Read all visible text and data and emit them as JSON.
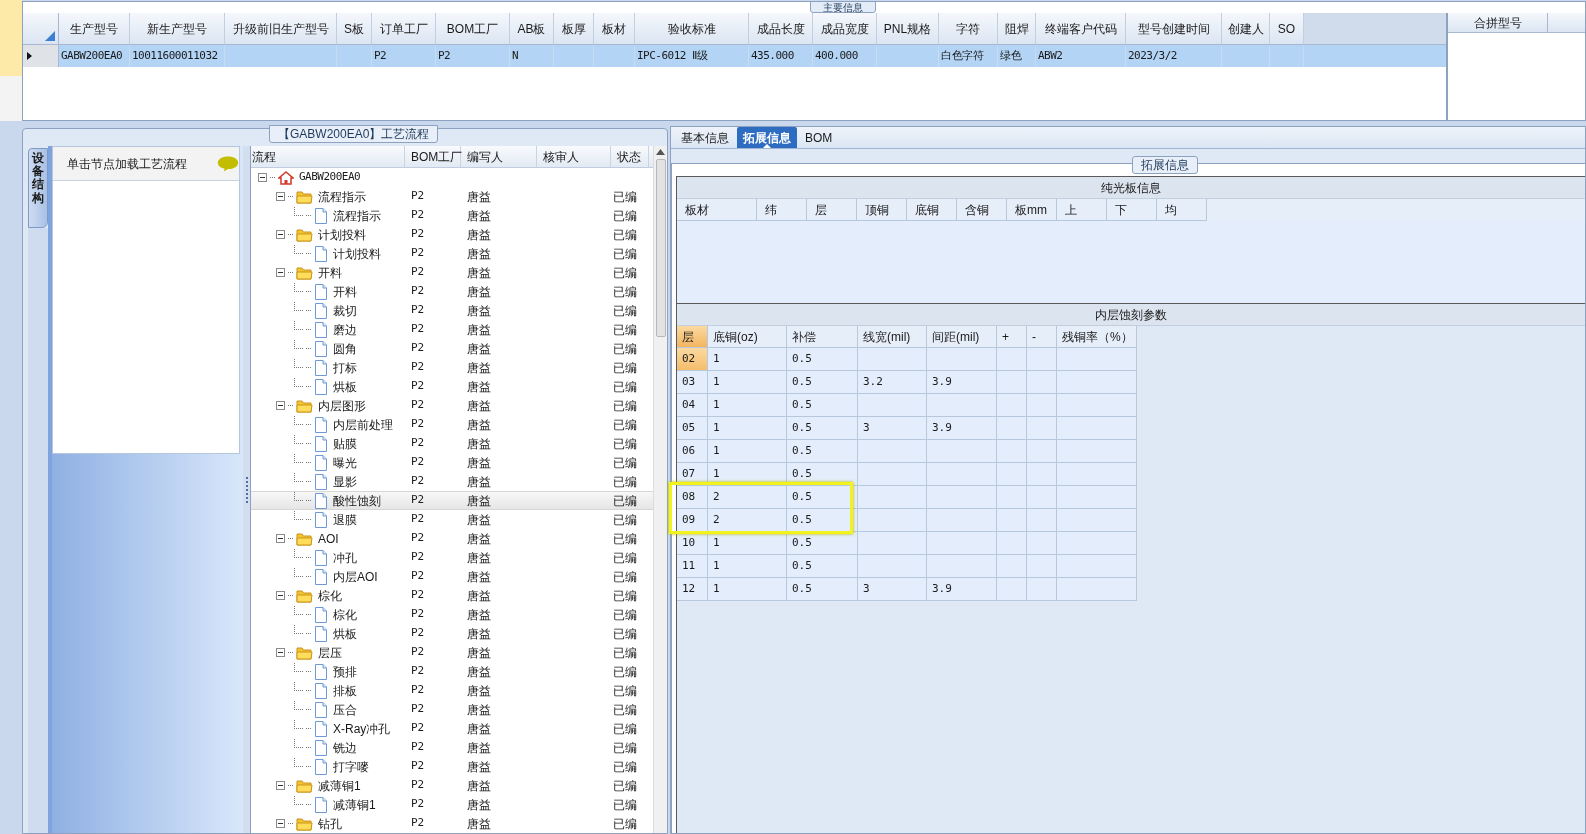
{
  "main_info": {
    "title": "主要信息",
    "columns": [
      "生产型号",
      "新生产型号",
      "升级前旧生产型号",
      "S板",
      "订单工厂",
      "BOM工厂",
      "AB板",
      "板厚",
      "板材",
      "验收标准",
      "成品长度",
      "成品宽度",
      "PNL规格",
      "字符",
      "阻焊",
      "终端客户代码",
      "型号创建时间",
      "创建人",
      "SO"
    ],
    "rows": [
      {
        "selected": true,
        "cells": [
          "GABW200EA0",
          "10011600011032",
          null,
          null,
          "P2",
          "P2",
          "N",
          null,
          null,
          "IPC-6012 Ⅱ级",
          "435.000",
          "400.000",
          null,
          "白色字符",
          "绿色",
          "ABW2",
          "2023/3/2",
          null,
          null
        ]
      }
    ]
  },
  "merge_panel": {
    "columns": [
      "合拼型号"
    ]
  },
  "process": {
    "title": "【GABW200EA0】工艺流程",
    "side_tab": "设备结构",
    "hint": "单击节点加载工艺流程",
    "columns": [
      "流程",
      "BOM工厂",
      "编写人",
      "核审人",
      "状态"
    ],
    "tree": [
      {
        "kind": "root",
        "label": "GABW200EA0",
        "expanded": true,
        "selected": false,
        "children": [
          {
            "kind": "folder",
            "label": "流程指示",
            "bom": "P2",
            "writer": "唐益",
            "status": "已编",
            "expanded": true,
            "selected": false,
            "children": [
              {
                "kind": "file",
                "label": "流程指示",
                "bom": "P2",
                "writer": "唐益",
                "status": "已编",
                "selected": false
              }
            ]
          },
          {
            "kind": "folder",
            "label": "计划投料",
            "bom": "P2",
            "writer": "唐益",
            "status": "已编",
            "expanded": true,
            "selected": false,
            "children": [
              {
                "kind": "file",
                "label": "计划投料",
                "bom": "P2",
                "writer": "唐益",
                "status": "已编",
                "selected": false
              }
            ]
          },
          {
            "kind": "folder",
            "label": "开料",
            "bom": "P2",
            "writer": "唐益",
            "status": "已编",
            "expanded": true,
            "selected": false,
            "children": [
              {
                "kind": "file",
                "label": "开料",
                "bom": "P2",
                "writer": "唐益",
                "status": "已编",
                "selected": false
              },
              {
                "kind": "file",
                "label": "裁切",
                "bom": "P2",
                "writer": "唐益",
                "status": "已编",
                "selected": false
              },
              {
                "kind": "file",
                "label": "磨边",
                "bom": "P2",
                "writer": "唐益",
                "status": "已编",
                "selected": false
              },
              {
                "kind": "file",
                "label": "圆角",
                "bom": "P2",
                "writer": "唐益",
                "status": "已编",
                "selected": false
              },
              {
                "kind": "file",
                "label": "打标",
                "bom": "P2",
                "writer": "唐益",
                "status": "已编",
                "selected": false
              },
              {
                "kind": "file",
                "label": "烘板",
                "bom": "P2",
                "writer": "唐益",
                "status": "已编",
                "selected": false
              }
            ]
          },
          {
            "kind": "folder",
            "label": "内层图形",
            "bom": "P2",
            "writer": "唐益",
            "status": "已编",
            "expanded": true,
            "selected": false,
            "children": [
              {
                "kind": "file",
                "label": "内层前处理",
                "bom": "P2",
                "writer": "唐益",
                "status": "已编",
                "selected": false
              },
              {
                "kind": "file",
                "label": "贴膜",
                "bom": "P2",
                "writer": "唐益",
                "status": "已编",
                "selected": false
              },
              {
                "kind": "file",
                "label": "曝光",
                "bom": "P2",
                "writer": "唐益",
                "status": "已编",
                "selected": false
              },
              {
                "kind": "file",
                "label": "显影",
                "bom": "P2",
                "writer": "唐益",
                "status": "已编",
                "selected": false
              },
              {
                "kind": "file",
                "label": "酸性蚀刻",
                "bom": "P2",
                "writer": "唐益",
                "status": "已编",
                "selected": true
              },
              {
                "kind": "file",
                "label": "退膜",
                "bom": "P2",
                "writer": "唐益",
                "status": "已编",
                "selected": false
              }
            ]
          },
          {
            "kind": "folder",
            "label": "AOI",
            "bom": "P2",
            "writer": "唐益",
            "status": "已编",
            "expanded": true,
            "selected": false,
            "children": [
              {
                "kind": "file",
                "label": "冲孔",
                "bom": "P2",
                "writer": "唐益",
                "status": "已编",
                "selected": false
              },
              {
                "kind": "file",
                "label": "内层AOI",
                "bom": "P2",
                "writer": "唐益",
                "status": "已编",
                "selected": false
              }
            ]
          },
          {
            "kind": "folder",
            "label": "棕化",
            "bom": "P2",
            "writer": "唐益",
            "status": "已编",
            "expanded": true,
            "selected": false,
            "children": [
              {
                "kind": "file",
                "label": "棕化",
                "bom": "P2",
                "writer": "唐益",
                "status": "已编",
                "selected": false
              },
              {
                "kind": "file",
                "label": "烘板",
                "bom": "P2",
                "writer": "唐益",
                "status": "已编",
                "selected": false
              }
            ]
          },
          {
            "kind": "folder",
            "label": "层压",
            "bom": "P2",
            "writer": "唐益",
            "status": "已编",
            "expanded": true,
            "selected": false,
            "children": [
              {
                "kind": "file",
                "label": "预排",
                "bom": "P2",
                "writer": "唐益",
                "status": "已编",
                "selected": false
              },
              {
                "kind": "file",
                "label": "排板",
                "bom": "P2",
                "writer": "唐益",
                "status": "已编",
                "selected": false
              },
              {
                "kind": "file",
                "label": "压合",
                "bom": "P2",
                "writer": "唐益",
                "status": "已编",
                "selected": false
              },
              {
                "kind": "file",
                "label": "X-Ray冲孔",
                "bom": "P2",
                "writer": "唐益",
                "status": "已编",
                "selected": false
              },
              {
                "kind": "file",
                "label": "铣边",
                "bom": "P2",
                "writer": "唐益",
                "status": "已编",
                "selected": false
              },
              {
                "kind": "file",
                "label": "打字嘜",
                "bom": "P2",
                "writer": "唐益",
                "status": "已编",
                "selected": false
              }
            ]
          },
          {
            "kind": "folder",
            "label": "减薄铜1",
            "bom": "P2",
            "writer": "唐益",
            "status": "已编",
            "expanded": true,
            "selected": false,
            "children": [
              {
                "kind": "file",
                "label": "减薄铜1",
                "bom": "P2",
                "writer": "唐益",
                "status": "已编",
                "selected": false
              }
            ]
          },
          {
            "kind": "folder",
            "label": "钻孔",
            "bom": "P2",
            "writer": "唐益",
            "status": "已编",
            "expanded": true,
            "selected": false
          }
        ]
      }
    ]
  },
  "tabs": [
    {
      "label": "基本信息",
      "selected": false
    },
    {
      "label": "拓展信息",
      "selected": true
    },
    {
      "label": "BOM",
      "selected": false
    }
  ],
  "ext_group": {
    "title": "拓展信息"
  },
  "bare_board": {
    "title": "纯光板信息",
    "columns": [
      "板材",
      "纬",
      "层",
      "顶铜",
      "底铜",
      "含铜",
      "板mm",
      "上",
      "下",
      "均"
    ]
  },
  "inner_etch": {
    "title": "内层蚀刻参数",
    "columns": [
      "层",
      "底铜(oz)",
      "补偿",
      "线宽(mil)",
      "间距(mil)",
      "+",
      "-",
      "残铜率（%）"
    ],
    "rows": [
      {
        "selected": true,
        "highlighted": false,
        "cells": [
          "02",
          "1",
          "0.5",
          null,
          null,
          null,
          null,
          null
        ]
      },
      {
        "selected": false,
        "highlighted": false,
        "cells": [
          "03",
          "1",
          "0.5",
          "3.2",
          "3.9",
          null,
          null,
          null
        ]
      },
      {
        "selected": false,
        "highlighted": false,
        "cells": [
          "04",
          "1",
          "0.5",
          null,
          null,
          null,
          null,
          null
        ]
      },
      {
        "selected": false,
        "highlighted": false,
        "cells": [
          "05",
          "1",
          "0.5",
          "3",
          "3.9",
          null,
          null,
          null
        ]
      },
      {
        "selected": false,
        "highlighted": false,
        "cells": [
          "06",
          "1",
          "0.5",
          null,
          null,
          null,
          null,
          null
        ]
      },
      {
        "selected": false,
        "highlighted": false,
        "cells": [
          "07",
          "1",
          "0.5",
          null,
          null,
          null,
          null,
          null
        ]
      },
      {
        "selected": false,
        "highlighted": true,
        "cells": [
          "08",
          "2",
          "0.5",
          null,
          null,
          null,
          null,
          null
        ]
      },
      {
        "selected": false,
        "highlighted": true,
        "cells": [
          "09",
          "2",
          "0.5",
          null,
          null,
          null,
          null,
          null
        ]
      },
      {
        "selected": false,
        "highlighted": false,
        "cells": [
          "10",
          "1",
          "0.5",
          null,
          null,
          null,
          null,
          null
        ]
      },
      {
        "selected": false,
        "highlighted": false,
        "cells": [
          "11",
          "1",
          "0.5",
          null,
          null,
          null,
          null,
          null
        ]
      },
      {
        "selected": false,
        "highlighted": false,
        "cells": [
          "12",
          "1",
          "0.5",
          "3",
          "3.9",
          null,
          null,
          null
        ]
      }
    ]
  }
}
